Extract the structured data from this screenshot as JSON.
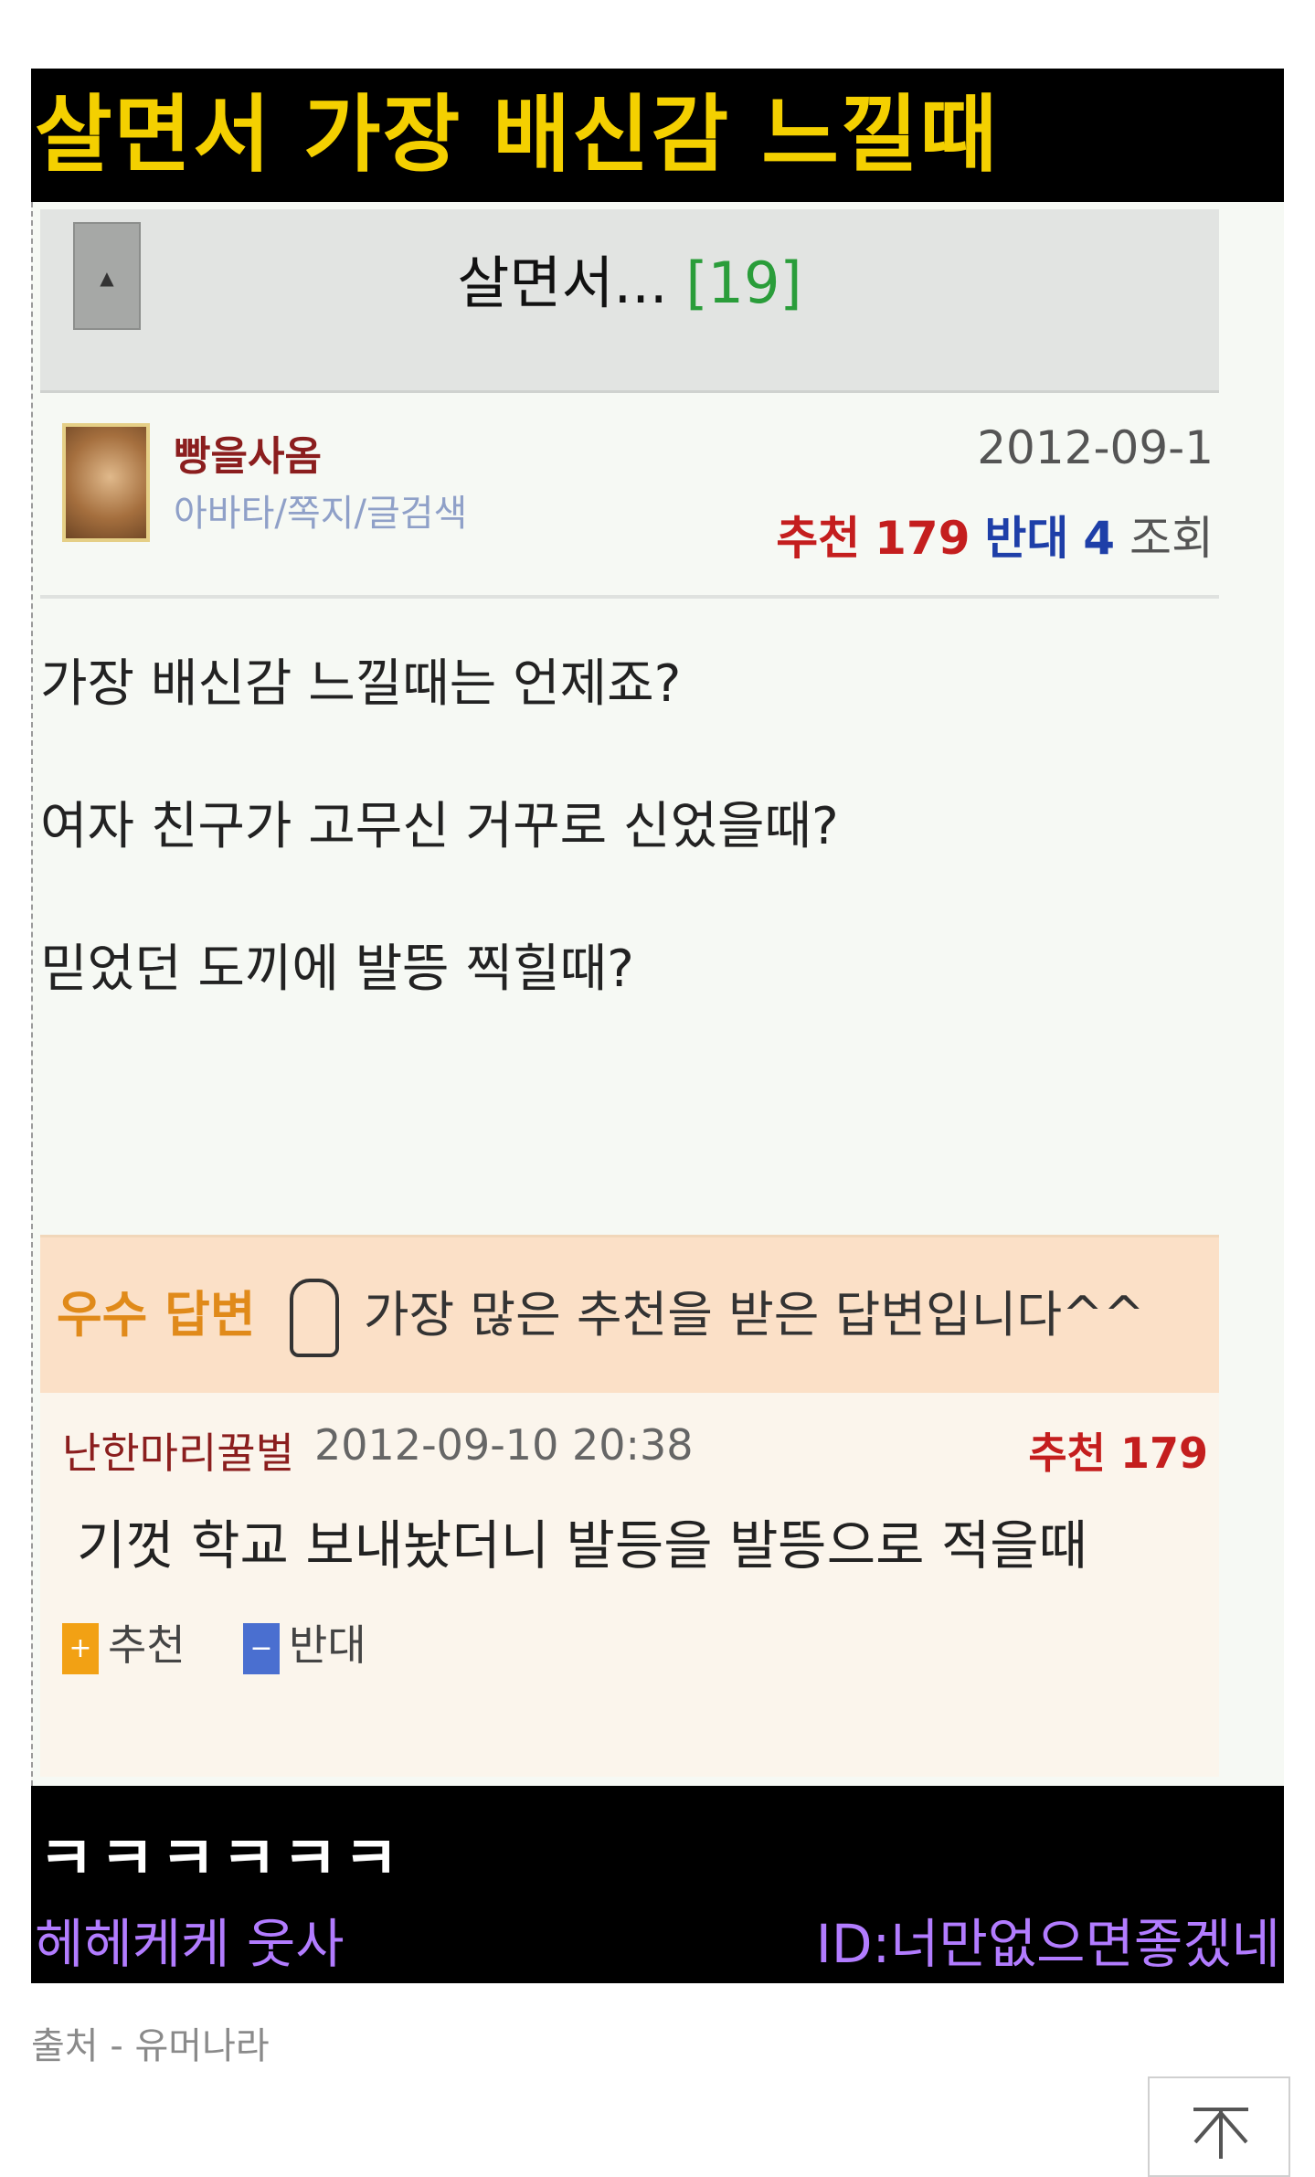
{
  "title_bar": "살면서 가장 배신감 느낄때",
  "nav": {
    "back_icon": "▲",
    "title": "살면서...",
    "count": "[19]"
  },
  "post": {
    "nick": "빵을사옴",
    "links": "아바타/쪽지/글검색",
    "date": "2012-09-1",
    "rec_label": "추천",
    "rec_value": "179",
    "opp_label": "반대",
    "opp_value": "4",
    "views_label": "조회",
    "lines": [
      "가장 배신감 느낄때는 언제죠?",
      "여자 친구가 고무신 거꾸로 신었을때?",
      "믿었던 도끼에 발뜽 찍힐때?"
    ]
  },
  "answer": {
    "label": "우수 답변",
    "desc": "가장 많은 추천을 받은 답변입니다^^",
    "user": "난한마리꿀벌",
    "date": "2012-09-10 20:38",
    "rec": "추천 179",
    "text": "기껏 학교 보내놨더니 발등을 발뜽으로 적을때",
    "up_label": "추천",
    "down_label": "반대"
  },
  "bottom": {
    "laugh": "ㅋㅋㅋㅋㅋㅋ",
    "left": "헤헤케케 웃사",
    "right": "ID:너만없으면좋겠네"
  },
  "source": "출처 - 유머나라",
  "colors": {
    "title": "#f4d000",
    "footer_text": "#b27cff",
    "answer_accent": "#e08a1a"
  }
}
